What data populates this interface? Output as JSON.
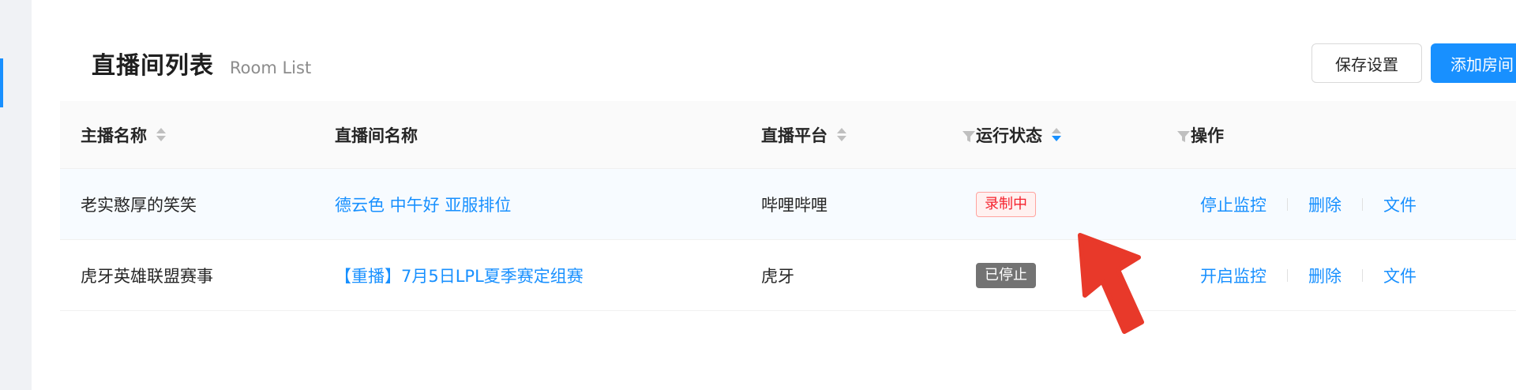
{
  "header": {
    "title": "直播间列表",
    "subtitle": "Room List"
  },
  "toolbar": {
    "save_label": "保存设置",
    "add_label": "添加房间"
  },
  "table": {
    "columns": {
      "anchor": "主播名称",
      "room": "直播间名称",
      "platform": "直播平台",
      "status": "运行状态",
      "ops": "操作"
    },
    "rows": [
      {
        "anchor": "老实憨厚的笑笑",
        "room": "德云色 中午好 亚服排位",
        "platform": "哔哩哔哩",
        "status": "录制中",
        "ops": [
          "停止监控",
          "删除",
          "文件"
        ]
      },
      {
        "anchor": "虎牙英雄联盟赛事",
        "room": "【重播】7月5日LPL夏季赛定组赛",
        "platform": "虎牙",
        "status": "已停止",
        "ops": [
          "开启监控",
          "删除",
          "文件"
        ]
      }
    ]
  },
  "colors": {
    "primary": "#1890ff",
    "recording": "#f5222d",
    "stopped": "#737373",
    "cursor": "#e8392a"
  },
  "icons": {
    "sort": "sort-caret-icon",
    "filter": "filter-funnel-icon",
    "pointer": "arrow-cursor-icon"
  }
}
